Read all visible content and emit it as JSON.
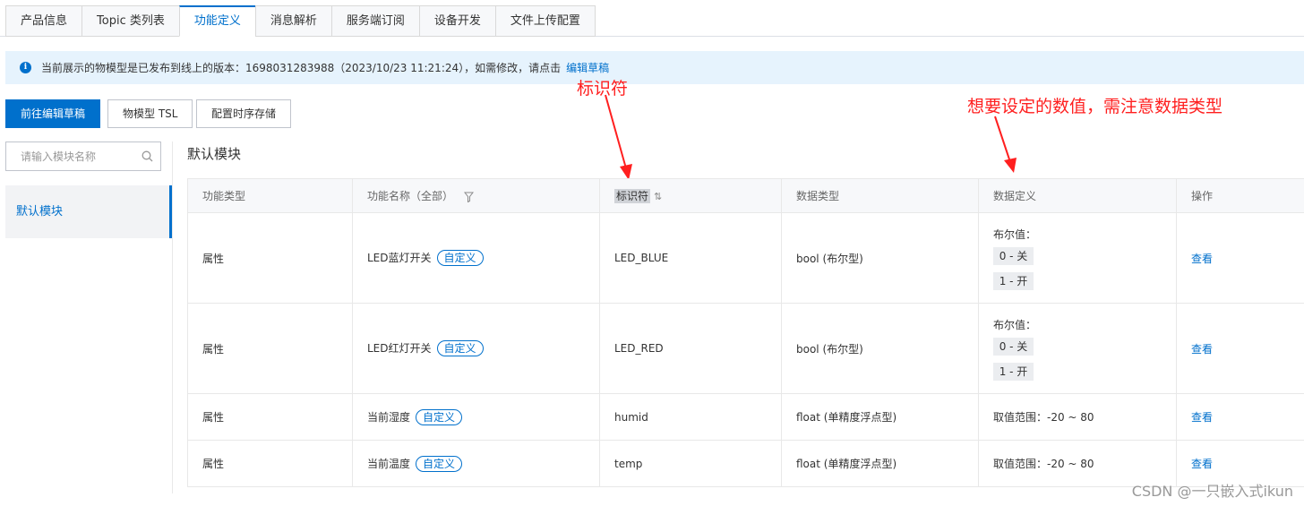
{
  "tabs": [
    {
      "label": "产品信息"
    },
    {
      "label": "Topic 类列表"
    },
    {
      "label": "功能定义"
    },
    {
      "label": "消息解析"
    },
    {
      "label": "服务端订阅"
    },
    {
      "label": "设备开发"
    },
    {
      "label": "文件上传配置"
    }
  ],
  "notice": {
    "icon": "info-icon",
    "text": "当前展示的物模型是已发布到线上的版本：1698031283988（2023/10/23 11:21:24），如需修改，请点击",
    "link": "编辑草稿"
  },
  "toolbar": {
    "edit_draft": "前往编辑草稿",
    "tsl": "物模型 TSL",
    "storage": "配置时序存储"
  },
  "annotations": {
    "identifier": "标识符",
    "value_hint": "想要设定的数值，需注意数据类型"
  },
  "sidebar": {
    "search_placeholder": "请输入模块名称",
    "item": "默认模块"
  },
  "module_title": "默认模块",
  "table": {
    "headers": {
      "type": "功能类型",
      "name": "功能名称（全部）",
      "identifier": "标识符",
      "datatype": "数据类型",
      "definition": "数据定义",
      "action": "操作"
    },
    "rows": [
      {
        "type": "属性",
        "name": "LED蓝灯开关",
        "tag": "自定义",
        "identifier": "LED_BLUE",
        "datatype": "bool (布尔型)",
        "def_label": "布尔值：",
        "def_items": [
          "0 - 关",
          "1 - 开"
        ],
        "action": "查看"
      },
      {
        "type": "属性",
        "name": "LED红灯开关",
        "tag": "自定义",
        "identifier": "LED_RED",
        "datatype": "bool (布尔型)",
        "def_label": "布尔值：",
        "def_items": [
          "0 - 关",
          "1 - 开"
        ],
        "action": "查看"
      },
      {
        "type": "属性",
        "name": "当前湿度",
        "tag": "自定义",
        "identifier": "humid",
        "datatype": "float (单精度浮点型)",
        "def_text": "取值范围：-20 ~ 80",
        "action": "查看"
      },
      {
        "type": "属性",
        "name": "当前温度",
        "tag": "自定义",
        "identifier": "temp",
        "datatype": "float (单精度浮点型)",
        "def_text": "取值范围：-20 ~ 80",
        "action": "查看"
      }
    ]
  },
  "watermark": "CSDN @一只嵌入式ikun",
  "colors": {
    "accent": "#0070cc",
    "annotation": "#ff1f1f",
    "notice_bg": "#e6f3fd"
  }
}
